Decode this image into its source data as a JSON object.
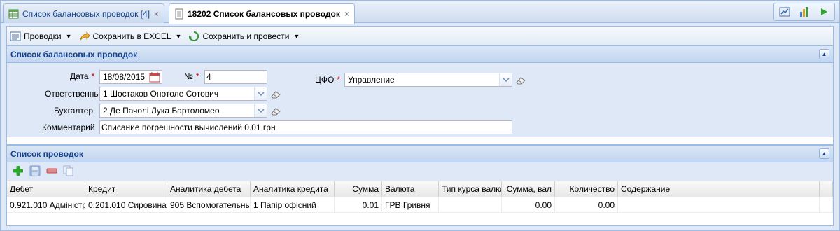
{
  "tabs": [
    {
      "label": "Список балансовых проводок [4]",
      "active": false
    },
    {
      "label": "18202 Список балансовых проводок",
      "active": true
    }
  ],
  "tab_close_glyph": "×",
  "tab_tools": [
    "chart-image-icon",
    "bar-chart-icon",
    "play-icon"
  ],
  "toolbar": {
    "entries_label": "Проводки",
    "excel_label": "Сохранить в EXCEL",
    "save_post_label": "Сохранить и провести"
  },
  "header_panel": {
    "title": "Список балансовых проводок",
    "date_label": "Дата",
    "date_value": "18/08/2015",
    "number_label": "№",
    "number_value": "4",
    "cfo_label": "ЦФО",
    "cfo_value": "Управление",
    "responsible_label": "Ответственный",
    "responsible_value": "1 Шостаков Онотоле Сотович",
    "accountant_label": "Бухгалтер",
    "accountant_value": "2 Де Пачолі Лука Бартоломео",
    "comment_label": "Комментарий",
    "comment_value": "Списание погрешности вычислений 0.01 грн",
    "required_mark": "*"
  },
  "entries_panel": {
    "title": "Список проводок",
    "columns": [
      "Дебет",
      "Кредит",
      "Аналитика дебета",
      "Аналитика кредита",
      "Сумма",
      "Валюта",
      "Тип курса валю",
      "Сумма, вал",
      "Количество",
      "Содержание"
    ],
    "rows": [
      [
        "0.921.010 Адміністр",
        "0.201.010 Сировина",
        "905 Вспомогательны",
        "1 Папір офісний",
        "0.01",
        "ГРВ Гривня",
        "",
        "0.00",
        "0.00",
        ""
      ]
    ]
  },
  "colors": {
    "accent": "#15428b",
    "border": "#99bbe8",
    "panel_bg": "#dfe8f6",
    "required": "#cc0000"
  }
}
